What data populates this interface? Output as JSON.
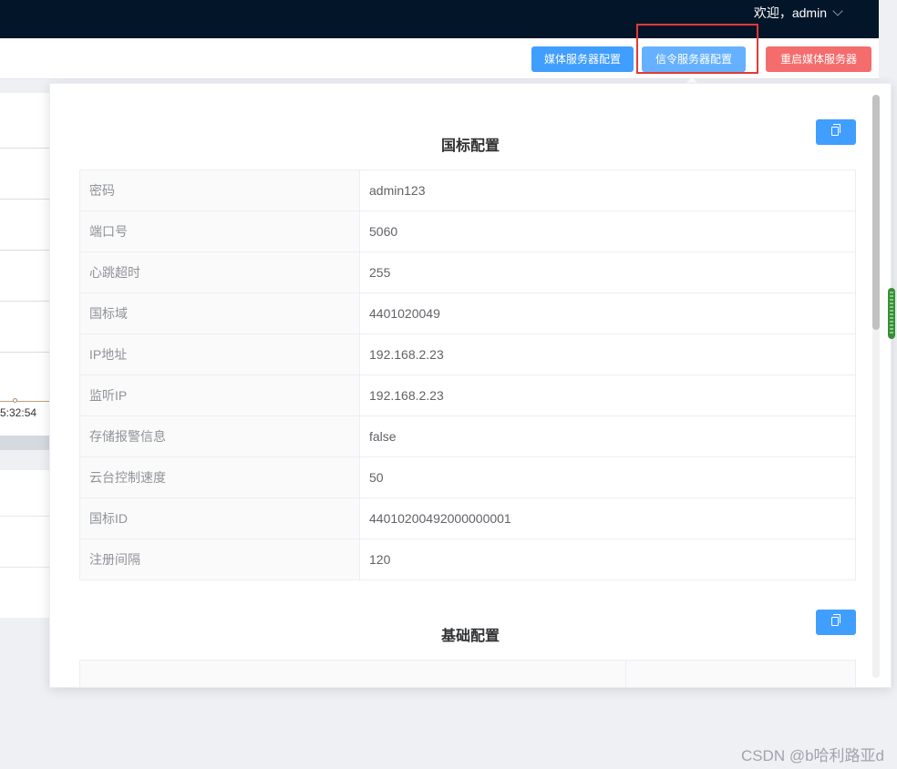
{
  "header": {
    "welcome_text": "欢迎，admin"
  },
  "toolbar": {
    "media_server_config": "媒体服务器配置",
    "signal_server_config": "信令服务器配置",
    "restart_media_server": "重启媒体服务器"
  },
  "background_panel": {
    "time_label": "5:32:54"
  },
  "gb_section": {
    "title": "国标配置",
    "rows": [
      {
        "label": "密码",
        "value": "admin123"
      },
      {
        "label": "端口号",
        "value": "5060"
      },
      {
        "label": "心跳超时",
        "value": "255"
      },
      {
        "label": "国标域",
        "value": "4401020049"
      },
      {
        "label": "IP地址",
        "value": "192.168.2.23"
      },
      {
        "label": "监听IP",
        "value": "192.168.2.23"
      },
      {
        "label": "存储报警信息",
        "value": "false"
      },
      {
        "label": "云台控制速度",
        "value": "50"
      },
      {
        "label": "国标ID",
        "value": "44010200492000000001"
      },
      {
        "label": "注册间隔",
        "value": "120"
      }
    ]
  },
  "basic_section": {
    "title": "基础配置"
  },
  "watermark": "CSDN @b哈利路亚d",
  "colors": {
    "primary": "#409eff",
    "danger": "#f56c6c",
    "header_bg": "#031529",
    "highlight": "#e53935"
  }
}
